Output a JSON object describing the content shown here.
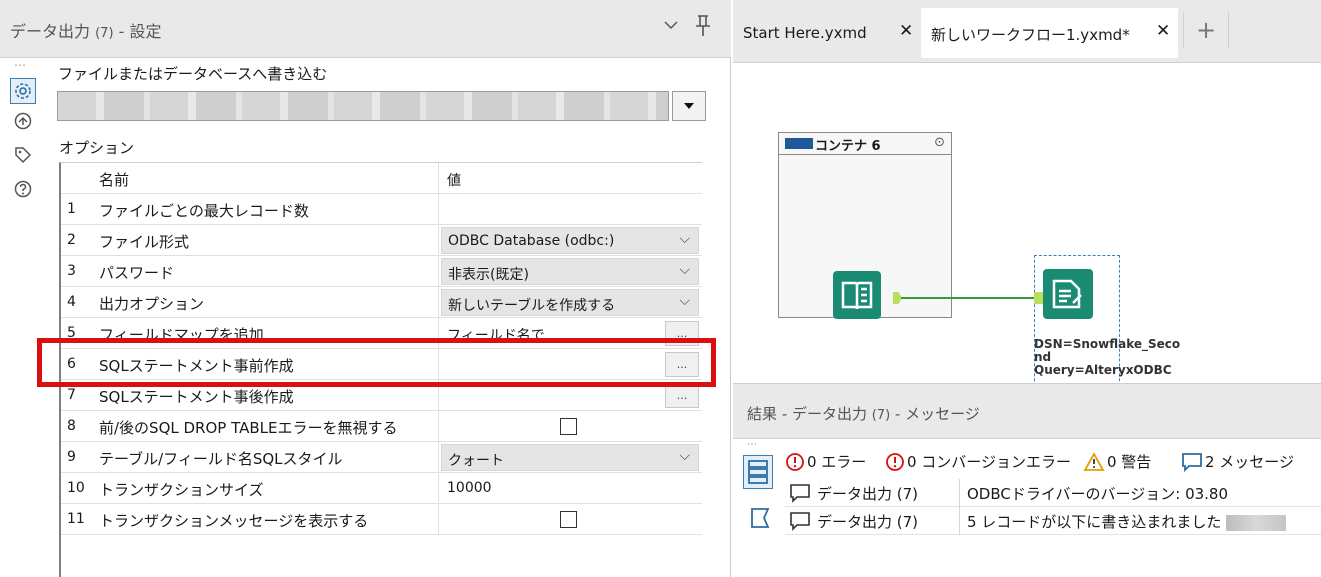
{
  "left_panel": {
    "title": "データ出力",
    "title_count": "(7)",
    "title_suffix": " - 設定",
    "write_label": "ファイルまたはデータベースへ書き込む",
    "options_label": "オプション",
    "grid": {
      "header_name": "名前",
      "header_value": "値",
      "rows": [
        {
          "num": "1",
          "name": "ファイルごとの最大レコード数",
          "value": ""
        },
        {
          "num": "2",
          "name": "ファイル形式",
          "value": "ODBC Database (odbc:)"
        },
        {
          "num": "3",
          "name": "パスワード",
          "value": "非表示(既定)"
        },
        {
          "num": "4",
          "name": "出力オプション",
          "value": "新しいテーブルを作成する"
        },
        {
          "num": "5",
          "name": "フィールドマップを追加",
          "value": "フィールド名で"
        },
        {
          "num": "6",
          "name": "SQLステートメント事前作成",
          "value": ""
        },
        {
          "num": "7",
          "name": "SQLステートメント事後作成",
          "value": ""
        },
        {
          "num": "8",
          "name": "前/後のSQL DROP TABLEエラーを無視する",
          "value": ""
        },
        {
          "num": "9",
          "name": "テーブル/フィールド名SQLスタイル",
          "value": "クォート"
        },
        {
          "num": "10",
          "name": "トランザクションサイズ",
          "value": "10000"
        },
        {
          "num": "11",
          "name": "トランザクションメッセージを表示する",
          "value": ""
        }
      ]
    },
    "ellipsis_label": "..."
  },
  "tabs": [
    {
      "label": "Start Here.yxmd"
    },
    {
      "label": "新しいワークフロー1.yxmd*"
    }
  ],
  "tab_close": "✕",
  "tab_add": "+",
  "canvas": {
    "container_label": "コンテナ 6",
    "annotation": "DSN=Snowflake_Second\nQuery=AlteryxODBC",
    "annot_line1": "DSN=Snowflake_Seco",
    "annot_line2": "nd",
    "annot_line3": "Query=AlteryxODBC"
  },
  "results": {
    "title": "結果 - データ出力",
    "title_count": "(7)",
    "title_suffix": " - メッセージ",
    "filters": {
      "errors": "0 エラー",
      "conversion_errors": "0 コンバージョンエラー",
      "warnings": "0 警告",
      "messages": "2 メッセージ"
    },
    "messages": [
      {
        "source": "データ出力 (7)",
        "text": "ODBCドライバーのバージョン: 03.80"
      },
      {
        "source": "データ出力 (7)",
        "text": "5 レコードが以下に書き込まれました"
      }
    ]
  },
  "colors": {
    "accent": "#1a8a72",
    "highlight_red": "#d81010",
    "container_toggle": "#1e5a9a"
  }
}
